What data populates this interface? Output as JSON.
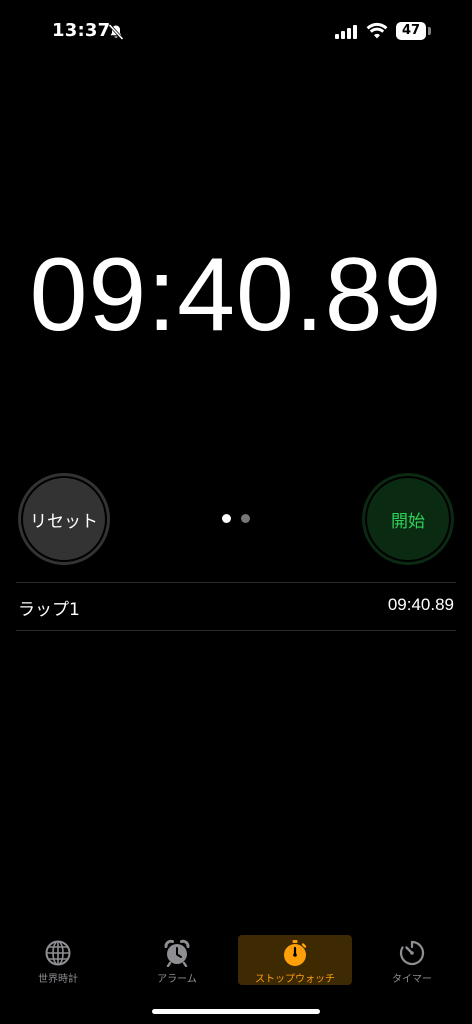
{
  "status_bar": {
    "time": "13:37",
    "battery_level": "47",
    "icons": [
      "bell-slash-icon",
      "cellular-signal-icon",
      "wifi-icon",
      "battery-icon"
    ]
  },
  "stopwatch": {
    "elapsed": "09:40.89"
  },
  "controls": {
    "reset_label": "リセット",
    "start_label": "開始",
    "page_count": 2,
    "active_page": 1
  },
  "laps": [
    {
      "label": "ラップ1",
      "time": "09:40.89"
    }
  ],
  "tabs": [
    {
      "label": "世界時計",
      "icon": "globe-icon",
      "active": false
    },
    {
      "label": "アラーム",
      "icon": "alarm-clock-icon",
      "active": false
    },
    {
      "label": "ストップウォッチ",
      "icon": "stopwatch-icon",
      "active": true
    },
    {
      "label": "タイマー",
      "icon": "timer-icon",
      "active": false
    }
  ],
  "colors": {
    "background": "#000000",
    "accent": "#ff9f0a",
    "start_text": "#30d158",
    "start_bg": "#0a2a12",
    "reset_bg": "#333333",
    "inactive_tab": "#8e8e93"
  }
}
